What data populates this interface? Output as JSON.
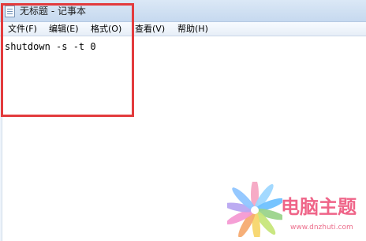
{
  "window": {
    "title": "无标题 - 记事本"
  },
  "menu": {
    "items": [
      {
        "label": "文件(F)"
      },
      {
        "label": "编辑(E)"
      },
      {
        "label": "格式(O)"
      },
      {
        "label": "查看(V)"
      },
      {
        "label": "帮助(H)"
      }
    ]
  },
  "editor": {
    "content": "shutdown -s -t 0"
  },
  "watermark": {
    "title": "电脑主题",
    "url": "www.dnzhuti.com"
  },
  "colors": {
    "highlight": "#e33b3d",
    "watermark": "#ef6488"
  },
  "icons": {
    "app": "notepad-icon",
    "watermark": "flower-logo-icon"
  }
}
